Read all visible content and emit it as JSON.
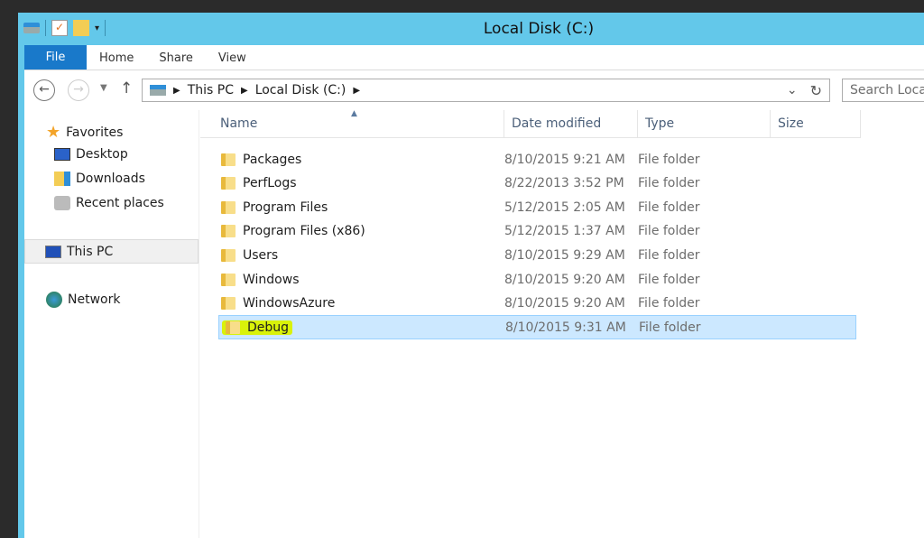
{
  "window": {
    "title": "Local Disk (C:)"
  },
  "ribbon": {
    "tabs": [
      "File",
      "Home",
      "Share",
      "View"
    ]
  },
  "address": {
    "crumbs": [
      "This PC",
      "Local Disk (C:)"
    ],
    "search_placeholder": "Search Local Disk (C:)"
  },
  "sidebar": {
    "favorites": "Favorites",
    "items": [
      "Desktop",
      "Downloads",
      "Recent places"
    ],
    "this_pc": "This PC",
    "network": "Network"
  },
  "columns": [
    "Name",
    "Date modified",
    "Type",
    "Size"
  ],
  "files": [
    {
      "name": "Packages",
      "date": "8/10/2015 9:21 AM",
      "type": "File folder"
    },
    {
      "name": "PerfLogs",
      "date": "8/22/2013 3:52 PM",
      "type": "File folder"
    },
    {
      "name": "Program Files",
      "date": "5/12/2015 2:05 AM",
      "type": "File folder"
    },
    {
      "name": "Program Files (x86)",
      "date": "5/12/2015 1:37 AM",
      "type": "File folder"
    },
    {
      "name": "Users",
      "date": "8/10/2015 9:29 AM",
      "type": "File folder"
    },
    {
      "name": "Windows",
      "date": "8/10/2015 9:20 AM",
      "type": "File folder"
    },
    {
      "name": "WindowsAzure",
      "date": "8/10/2015 9:20 AM",
      "type": "File folder"
    },
    {
      "name": "Debug",
      "date": "8/10/2015 9:31 AM",
      "type": "File folder",
      "selected": true
    }
  ],
  "colors": {
    "titlebar": "#63c8ea",
    "file_tab": "#1979ca",
    "selection": "#cce8ff",
    "highlight": "#d9f20a"
  }
}
